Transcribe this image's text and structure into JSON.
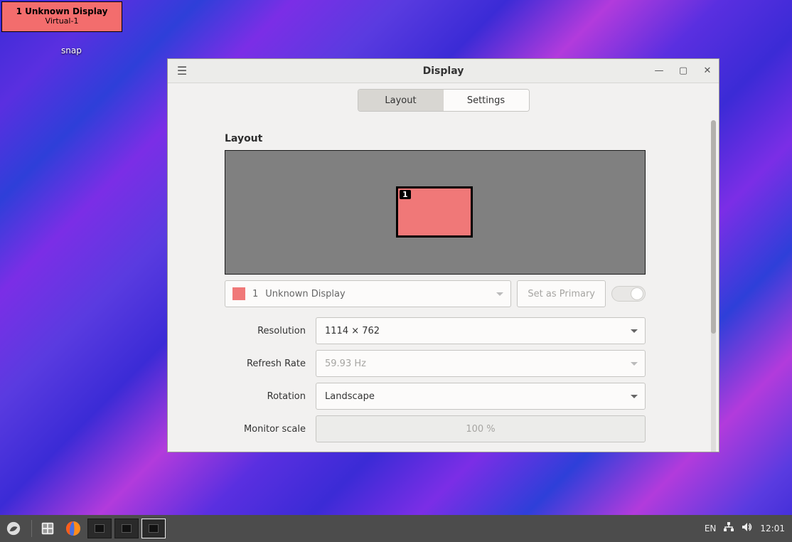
{
  "desktop": {
    "osd": {
      "line1": "1  Unknown Display",
      "line2": "Virtual-1"
    },
    "snap_label": "snap"
  },
  "window": {
    "title": "Display",
    "tabs": {
      "layout": "Layout",
      "settings": "Settings"
    },
    "section_heading": "Layout",
    "preview": {
      "monitor_index": "1"
    },
    "display_selector": {
      "index": "1",
      "name": "Unknown Display"
    },
    "set_primary": "Set as Primary",
    "fields": {
      "resolution": {
        "label": "Resolution",
        "value": "1114 × 762"
      },
      "refresh_rate": {
        "label": "Refresh Rate",
        "value": "59.93 Hz"
      },
      "rotation": {
        "label": "Rotation",
        "value": "Landscape"
      },
      "monitor_scale": {
        "label": "Monitor scale",
        "value": "100 %"
      }
    }
  },
  "taskbar": {
    "keyboard_layout": "EN",
    "clock": "12:01"
  }
}
